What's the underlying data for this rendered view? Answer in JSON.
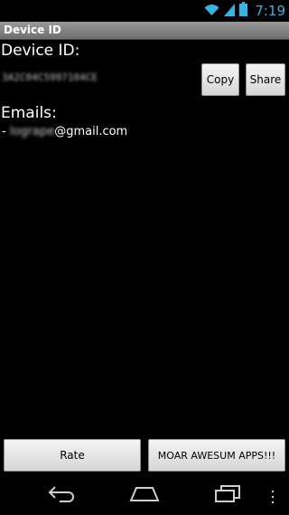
{
  "status": {
    "time": "7:19"
  },
  "app": {
    "title": "Device ID"
  },
  "device": {
    "label": "Device ID:",
    "value": "3A2C04C5997104CE"
  },
  "buttons": {
    "copy": "Copy",
    "share": "Share",
    "rate": "Rate",
    "moar": "MOAR AWESUM APPS!!!"
  },
  "emails": {
    "label": "Emails:",
    "prefix": "- ",
    "user_obscured": "logrape",
    "domain": "@gmail.com"
  },
  "icons": {
    "wifi": "wifi-icon",
    "signal": "signal-icon",
    "battery": "battery-icon",
    "back": "back-icon",
    "home": "home-icon",
    "recents": "recents-icon",
    "menu": "overflow-menu-icon"
  },
  "colors": {
    "time": "#33b5e5",
    "wifi": "#33b5e5"
  }
}
